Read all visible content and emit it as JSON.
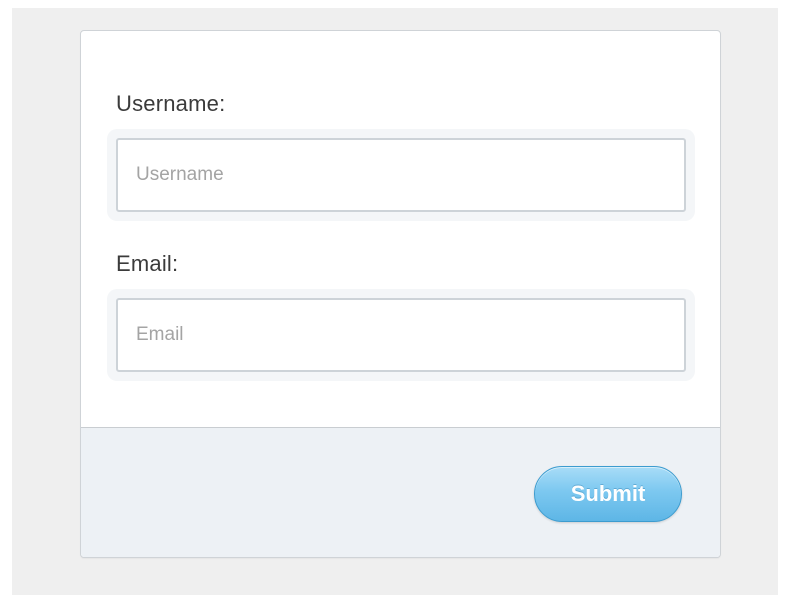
{
  "form": {
    "username": {
      "label": "Username:",
      "placeholder": "Username",
      "value": ""
    },
    "email": {
      "label": "Email:",
      "placeholder": "Email",
      "value": ""
    },
    "submit_label": "Submit"
  },
  "colors": {
    "page_background": "#efefef",
    "card_background": "#ffffff",
    "footer_background": "#edf1f5",
    "button_accent": "#7cc8f0",
    "button_text": "#ffffff"
  }
}
